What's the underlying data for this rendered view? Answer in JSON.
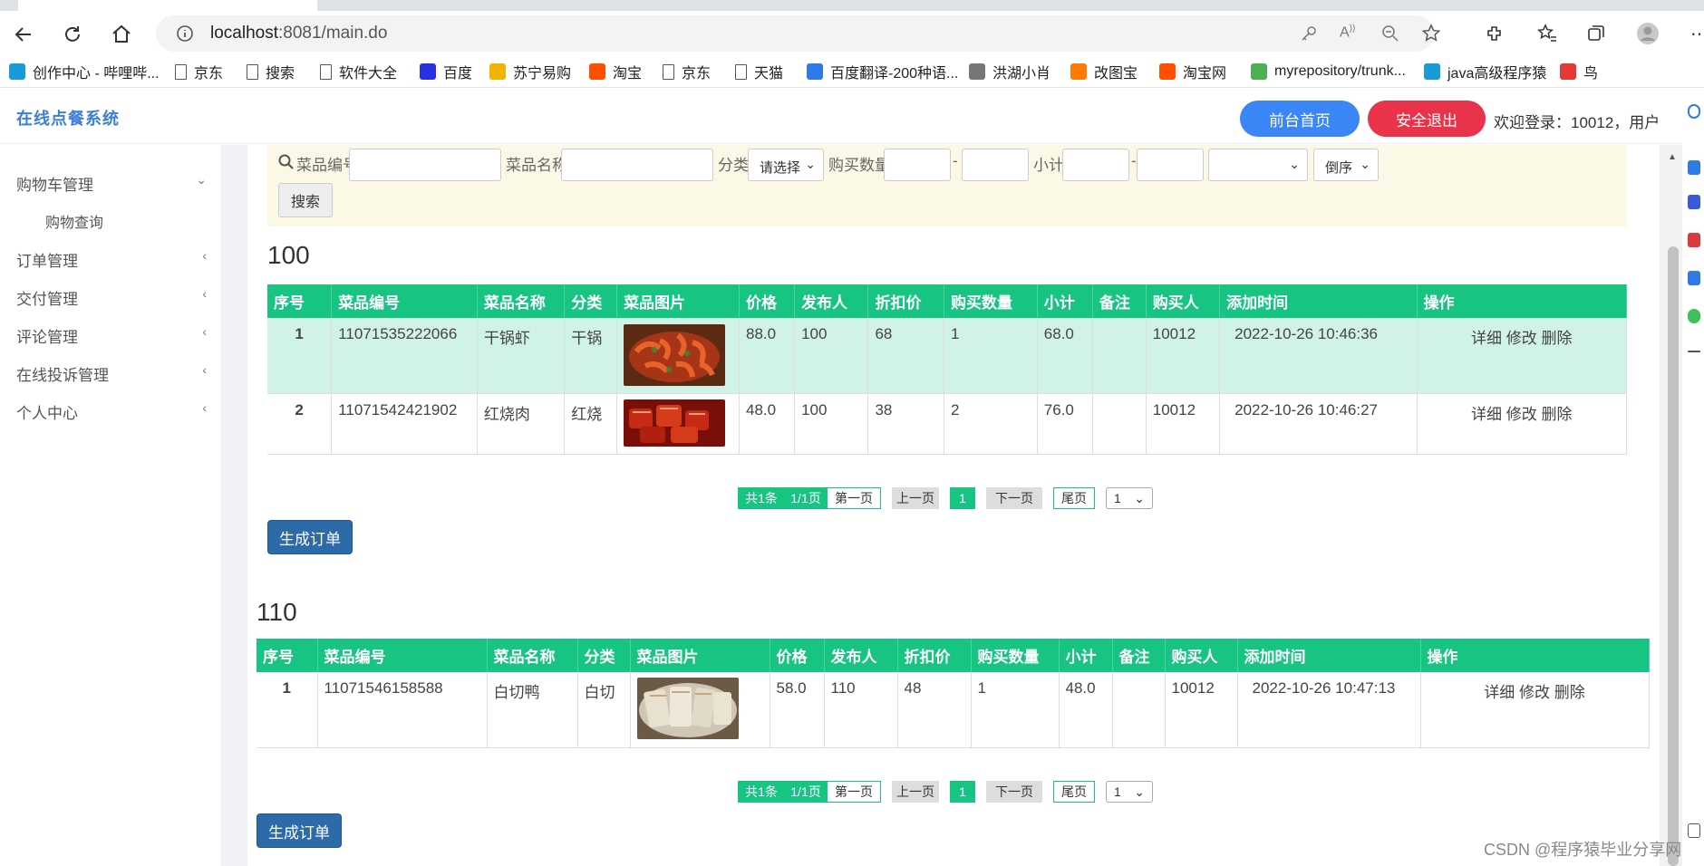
{
  "browser": {
    "url_host": "localhost",
    "url_rest": ":8081/main.do",
    "bookmarks": [
      {
        "label": "创作中心 - 哔哩哔...",
        "icon": "bilibili-icon",
        "color": "#1a9ad6"
      },
      {
        "label": "京东",
        "icon": "page-icon",
        "color": "#555555"
      },
      {
        "label": "搜索",
        "icon": "page-icon",
        "color": "#555555"
      },
      {
        "label": "软件大全",
        "icon": "page-icon",
        "color": "#555555"
      },
      {
        "label": "百度",
        "icon": "baidu-icon",
        "color": "#2932e1"
      },
      {
        "label": "苏宁易购",
        "icon": "suning-icon",
        "color": "#f2b300"
      },
      {
        "label": "淘宝",
        "icon": "taobao-icon",
        "color": "#ff5000"
      },
      {
        "label": "京东",
        "icon": "page-icon",
        "color": "#555555"
      },
      {
        "label": "天猫",
        "icon": "page-icon",
        "color": "#555555"
      },
      {
        "label": "百度翻译-200种语...",
        "icon": "translate-icon",
        "color": "#2f7be5"
      },
      {
        "label": "洪湖小肖",
        "icon": "bird-icon",
        "color": "#777777"
      },
      {
        "label": "改图宝",
        "icon": "gaitubao-icon",
        "color": "#ff7a00"
      },
      {
        "label": "淘宝网",
        "icon": "taobao-icon",
        "color": "#ff5000"
      },
      {
        "label": "myrepository/trunk...",
        "icon": "repo-icon",
        "color": "#4caf50"
      },
      {
        "label": "java高级程序猿",
        "icon": "bilibili-icon",
        "color": "#1a9ad6"
      },
      {
        "label": "鸟",
        "icon": "bird-icon",
        "color": "#e53935"
      }
    ]
  },
  "app": {
    "title": "在线点餐系统",
    "home_button": "前台首页",
    "logout_button": "安全退出",
    "welcome": "欢迎登录：10012，用户",
    "colors": {
      "accent": "#3d7fd8",
      "home": "#3b86f7",
      "logout": "#e8334a",
      "table_header": "#17c482",
      "highlight_row": "#d1f2e6",
      "gen_button": "#2c6aa8"
    }
  },
  "sidebar": {
    "items": [
      {
        "label": "购物车管理",
        "arrow": "⌄"
      },
      {
        "label": "购物查询",
        "arrow": ""
      },
      {
        "label": "订单管理",
        "arrow": "‹"
      },
      {
        "label": "交付管理",
        "arrow": "‹"
      },
      {
        "label": "评论管理",
        "arrow": "‹"
      },
      {
        "label": "在线投诉管理",
        "arrow": "‹"
      },
      {
        "label": "个人中心",
        "arrow": "‹"
      }
    ]
  },
  "search": {
    "code_label": "菜品编号",
    "name_label": "菜品名称",
    "category_label": "分类",
    "category_value": "请选择",
    "qty_label": "购买数量",
    "dash": "-",
    "subtotal_label": "小计",
    "order_value": "倒序",
    "search_button": "搜索"
  },
  "columns": [
    "序号",
    "菜品编号",
    "菜品名称",
    "分类",
    "菜品图片",
    "价格",
    "发布人",
    "折扣价",
    "购买数量",
    "小计",
    "备注",
    "购买人",
    "添加时间",
    "操作"
  ],
  "groups": [
    {
      "title": "100",
      "rows": [
        {
          "no": "1",
          "code": "11071535222066",
          "name": "干锅虾",
          "category": "干锅",
          "image": "dry-pot-shrimp",
          "price": "88.0",
          "publisher": "100",
          "discount": "68",
          "qty": "1",
          "subtotal": "68.0",
          "note": "",
          "buyer": "10012",
          "added": "2022-10-26 10:46:36",
          "ops": "详细 修改 删除"
        },
        {
          "no": "2",
          "code": "11071542421902",
          "name": "红烧肉",
          "category": "红烧",
          "image": "braised-pork",
          "price": "48.0",
          "publisher": "100",
          "discount": "38",
          "qty": "2",
          "subtotal": "76.0",
          "note": "",
          "buyer": "10012",
          "added": "2022-10-26 10:46:27",
          "ops": "详细 修改 删除"
        }
      ],
      "pager": {
        "summary": "共1条",
        "pages": "1/1页",
        "first": "第一页",
        "prev": "上一页",
        "current": "1",
        "next": "下一页",
        "last": "尾页",
        "select": "1"
      },
      "gen_button": "生成订单"
    },
    {
      "title": "110",
      "rows": [
        {
          "no": "1",
          "code": "11071546158588",
          "name": "白切鸭",
          "category": "白切",
          "image": "white-cut-duck",
          "price": "58.0",
          "publisher": "110",
          "discount": "48",
          "qty": "1",
          "subtotal": "48.0",
          "note": "",
          "buyer": "10012",
          "added": "2022-10-26 10:47:13",
          "ops": "详细 修改 删除"
        }
      ],
      "pager": {
        "summary": "共1条",
        "pages": "1/1页",
        "first": "第一页",
        "prev": "上一页",
        "current": "1",
        "next": "下一页",
        "last": "尾页",
        "select": "1"
      },
      "gen_button": "生成订单"
    }
  ],
  "watermark": "CSDN @程序猿毕业分享网"
}
